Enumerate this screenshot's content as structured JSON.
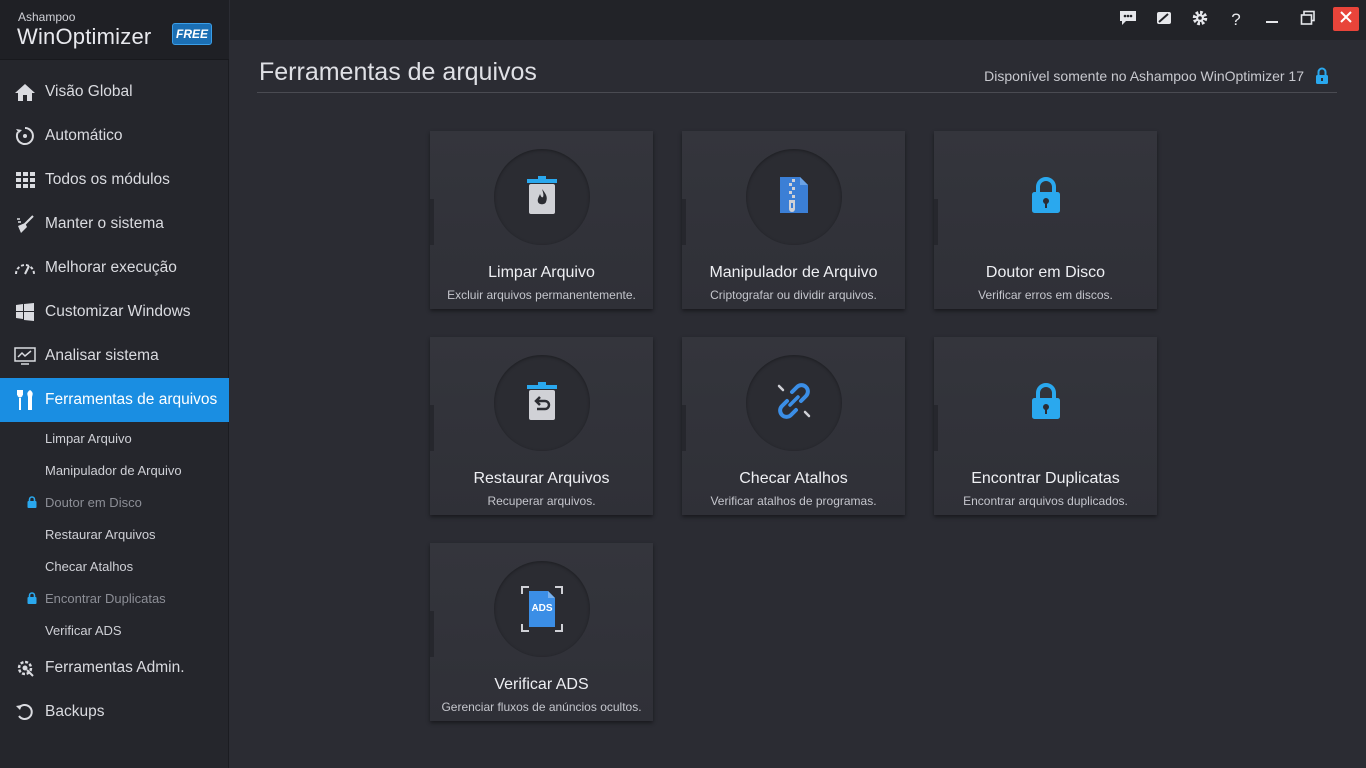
{
  "app": {
    "brand": "Ashampoo",
    "name": "WinOptimizer",
    "badge": "FREE"
  },
  "nav": {
    "items": [
      {
        "label": "Visão Global",
        "icon": "home-icon"
      },
      {
        "label": "Automático",
        "icon": "automatic-icon"
      },
      {
        "label": "Todos os módulos",
        "icon": "grid-icon"
      },
      {
        "label": "Manter o sistema",
        "icon": "broom-icon"
      },
      {
        "label": "Melhorar execução",
        "icon": "speedometer-icon"
      },
      {
        "label": "Customizar Windows",
        "icon": "windows-icon"
      },
      {
        "label": "Analisar sistema",
        "icon": "monitor-chart-icon"
      },
      {
        "label": "Ferramentas de arquivos",
        "icon": "tools-icon",
        "active": true
      }
    ],
    "sub_items": [
      {
        "label": "Limpar Arquivo",
        "locked": false
      },
      {
        "label": "Manipulador de Arquivo",
        "locked": false
      },
      {
        "label": "Doutor em Disco",
        "locked": true
      },
      {
        "label": "Restaurar Arquivos",
        "locked": false
      },
      {
        "label": "Checar Atalhos",
        "locked": false
      },
      {
        "label": "Encontrar Duplicatas",
        "locked": true
      },
      {
        "label": "Verificar ADS",
        "locked": false
      }
    ],
    "bottom_items": [
      {
        "label": "Ferramentas Admin.",
        "icon": "gear-admin-icon"
      },
      {
        "label": "Backups",
        "icon": "backup-icon"
      }
    ]
  },
  "topbar": {
    "icons": [
      "feedback-icon",
      "skin-icon",
      "settings-icon",
      "help-icon",
      "minimize-icon",
      "restore-icon",
      "close-icon"
    ],
    "help_label": "?"
  },
  "main": {
    "title": "Ferramentas de arquivos",
    "hint": "Disponível somente no Ashampoo WinOptimizer 17"
  },
  "cards": [
    {
      "title": "Limpar Arquivo",
      "desc": "Excluir arquivos permanentemente.",
      "icon": "shredder-trash-icon",
      "locked": false
    },
    {
      "title": "Manipulador de Arquivo",
      "desc": "Criptografar ou dividir arquivos.",
      "icon": "zip-file-icon",
      "locked": false
    },
    {
      "title": "Doutor em Disco",
      "desc": "Verificar erros em discos.",
      "icon": "lock-icon",
      "locked": true
    },
    {
      "title": "Restaurar Arquivos",
      "desc": "Recuperar arquivos.",
      "icon": "restore-trash-icon",
      "locked": false
    },
    {
      "title": "Checar Atalhos",
      "desc": "Verificar atalhos de programas.",
      "icon": "broken-link-icon",
      "locked": false
    },
    {
      "title": "Encontrar Duplicatas",
      "desc": "Encontrar arquivos duplicados.",
      "icon": "lock-icon",
      "locked": true
    },
    {
      "title": "Verificar ADS",
      "desc": "Gerenciar fluxos de anúncios ocultos.",
      "icon": "ads-file-icon",
      "locked": false,
      "icon_text": "ADS"
    }
  ],
  "colors": {
    "accent": "#1a8ee2",
    "lock": "#2aa8ee",
    "close": "#e8443a",
    "background": "#2b2c33",
    "sidebar": "#25262c"
  }
}
